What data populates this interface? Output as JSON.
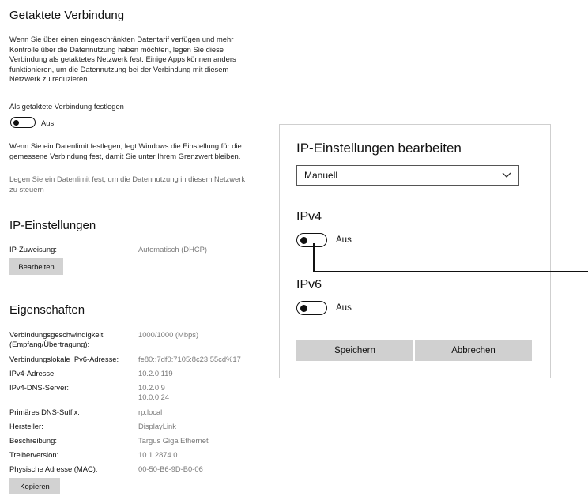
{
  "metered": {
    "title": "Getaktete Verbindung",
    "description": [
      "Wenn Sie über einen eingeschränkten Datentarif verfügen und mehr",
      "Kontrolle über die Datennutzung haben möchten, legen Sie diese",
      "Verbindung als getaktetes Netzwerk fest. Einige Apps können anders",
      "funktionieren, um die Datennutzung bei der Verbindung mit diesem",
      "Netzwerk zu reduzieren."
    ],
    "toggle_label": "Als getaktete Verbindung festlegen",
    "toggle_state": "Aus",
    "limit_note": [
      "Wenn Sie ein Datenlimit festlegen, legt Windows die Einstellung für die",
      "gemessene Verbindung fest, damit Sie unter Ihrem Grenzwert bleiben."
    ],
    "limit_link": [
      "Legen Sie ein Datenlimit fest, um die Datennutzung in diesem Netzwerk",
      "zu steuern"
    ]
  },
  "ip_settings": {
    "title": "IP-Einstellungen",
    "assignment_label": "IP-Zuweisung:",
    "assignment_value": "Automatisch (DHCP)",
    "edit_button": "Bearbeiten"
  },
  "properties": {
    "title": "Eigenschaften",
    "rows": [
      {
        "label": "Verbindungsgeschwindigkeit",
        "label2": "(Empfang/Übertragung):",
        "value": "1000/1000 (Mbps)"
      },
      {
        "label": "Verbindungslokale IPv6-Adresse:",
        "value": "fe80::7df0:7105:8c23:55cd%17"
      },
      {
        "label": "IPv4-Adresse:",
        "value": "10.2.0.119"
      },
      {
        "label": "IPv4-DNS-Server:",
        "value": "10.2.0.9",
        "value2": "10.0.0.24"
      },
      {
        "label": "Primäres DNS-Suffix:",
        "value": "rp.local"
      },
      {
        "label": "Hersteller:",
        "value": "DisplayLink"
      },
      {
        "label": "Beschreibung:",
        "value": "Targus Giga Ethernet"
      },
      {
        "label": "Treiberversion:",
        "value": "10.1.2874.0"
      },
      {
        "label": "Physische Adresse (MAC):",
        "value": "00-50-B6-9D-B0-06"
      }
    ],
    "copy_button": "Kopieren"
  },
  "dialog": {
    "title": "IP-Einstellungen bearbeiten",
    "mode_selected": "Manuell",
    "ipv4_heading": "IPv4",
    "ipv4_state": "Aus",
    "ipv6_heading": "IPv6",
    "ipv6_state": "Aus",
    "save_button": "Speichern",
    "cancel_button": "Abbrechen"
  }
}
